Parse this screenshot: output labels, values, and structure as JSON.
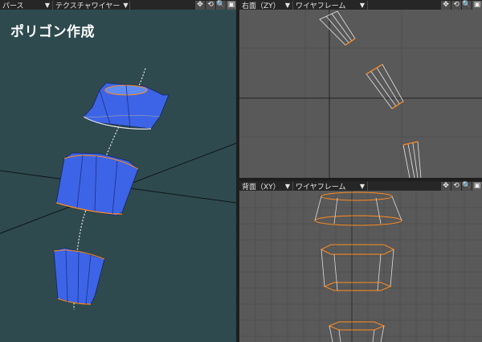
{
  "perspective_view": {
    "view_mode": "パース",
    "shading_mode": "テクスチャワイヤー",
    "title": "ポリゴン作成",
    "background_color": "#2e4a4f",
    "selected_edge_color": "#ff8a1e",
    "polygon_color": "#3d64e6"
  },
  "right_view": {
    "view_label": "右面（ZY）",
    "shading_mode": "ワイヤフレーム",
    "background_color": "#595959"
  },
  "back_view": {
    "view_label": "背面（XY）",
    "shading_mode": "ワイヤフレーム",
    "background_color": "#595959"
  },
  "viewport_tools": {
    "move_icon": "✥",
    "rotate_icon": "⟲",
    "zoom_icon": "🔍",
    "maximize_icon": "▣"
  }
}
